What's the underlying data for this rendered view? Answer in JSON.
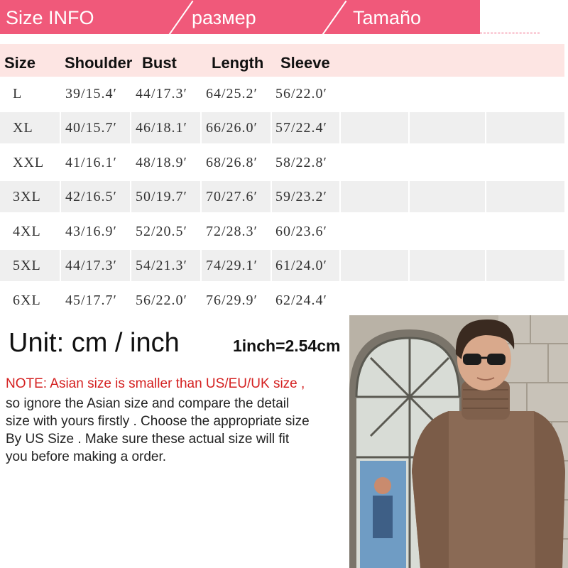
{
  "banner": {
    "tab1": "Size INFO",
    "tab2": "размер",
    "tab3": "Tamaño"
  },
  "table": {
    "headers": [
      "Size",
      "Shoulder",
      "Bust",
      "Length",
      "Sleeve"
    ],
    "rows": [
      [
        "L",
        "39/15.4′",
        "44/17.3′",
        "64/25.2′",
        "56/22.0′"
      ],
      [
        "XL",
        "40/15.7′",
        "46/18.1′",
        "66/26.0′",
        "57/22.4′"
      ],
      [
        "XXL",
        "41/16.1′",
        "48/18.9′",
        "68/26.8′",
        "58/22.8′"
      ],
      [
        "3XL",
        "42/16.5′",
        "50/19.7′",
        "70/27.6′",
        "59/23.2′"
      ],
      [
        "4XL",
        "43/16.9′",
        "52/20.5′",
        "72/28.3′",
        "60/23.6′"
      ],
      [
        "5XL",
        "44/17.3′",
        "54/21.3′",
        "74/29.1′",
        "61/24.0′"
      ],
      [
        "6XL",
        "45/17.7′",
        "56/22.0′",
        "76/29.9′",
        "62/24.4′"
      ]
    ]
  },
  "unit": {
    "label": "Unit: cm / inch",
    "conversion": "1inch=2.54cm"
  },
  "note": {
    "heading": "NOTE: Asian size is smaller than US/EU/UK size ,",
    "lines": [
      " so ignore the Asian size and compare the detail",
      "size with yours firstly . Choose the appropriate size",
      "By US Size . Make sure these actual size will fit",
      "you before making a order."
    ]
  },
  "colors": {
    "banner": "#f0597a",
    "header_row": "#fde5e3",
    "alt_row": "#efefef",
    "note_heading": "#d42020",
    "sweater": "#8a6a55"
  },
  "photo": {
    "icon": "model-photo"
  }
}
